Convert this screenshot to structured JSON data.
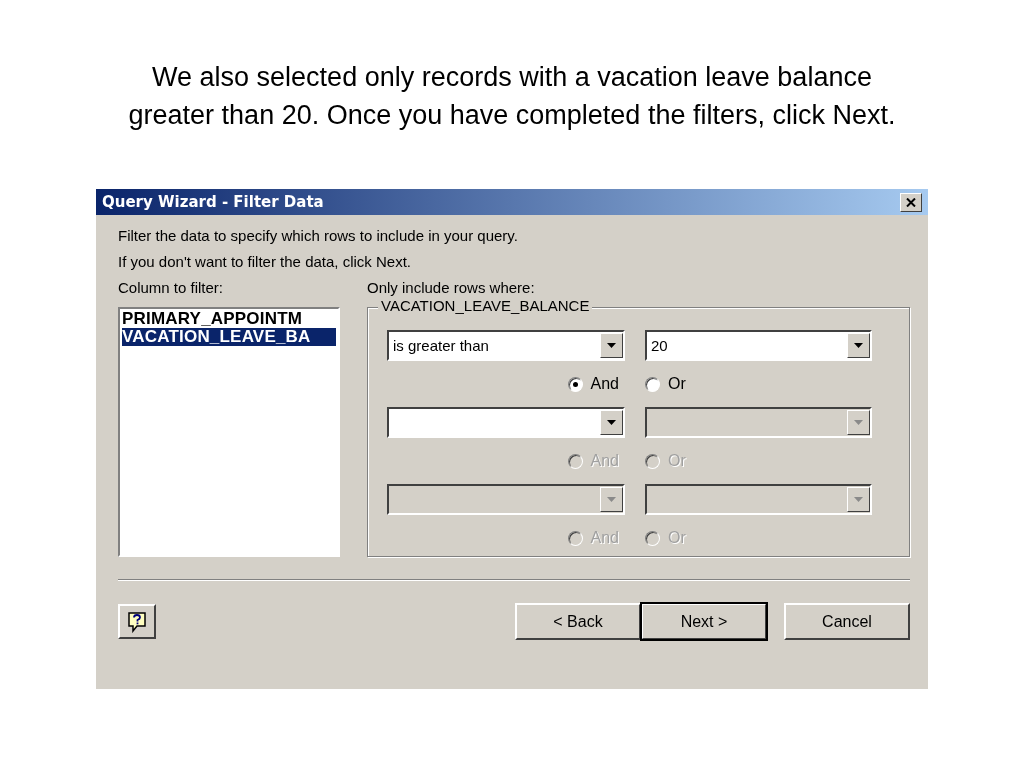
{
  "caption": [
    "We also selected only records with a vacation leave balance",
    "greater than 20. Once you have completed the filters, click Next."
  ],
  "window": {
    "title": "Query Wizard - Filter Data"
  },
  "intro": [
    "Filter the data to specify which rows to include in your query.",
    "If you don't want to filter the data, click Next."
  ],
  "column_label": "Column to filter:",
  "columns": [
    {
      "label": "PRIMARY_APPOINTM",
      "selected": false
    },
    {
      "label": "VACATION_LEAVE_BA",
      "selected": true
    }
  ],
  "criteria_label": "Only include rows where:",
  "group_title": "VACATION_LEAVE_BALANCE",
  "conditions": [
    {
      "operator": {
        "value": "is greater than",
        "disabled": false
      },
      "operand": {
        "value": "20",
        "disabled": false
      },
      "and": {
        "label": "And",
        "selected": true,
        "disabled": false
      },
      "or": {
        "label": "Or",
        "selected": false,
        "disabled": false
      }
    },
    {
      "operator": {
        "disabled": false
      },
      "operand": {
        "disabled": true
      },
      "and": {
        "label": "And",
        "selected": false,
        "disabled": true
      },
      "or": {
        "label": "Or",
        "selected": false,
        "disabled": true
      }
    },
    {
      "operator": {
        "disabled": true
      },
      "operand": {
        "disabled": true
      },
      "and": {
        "label": "And",
        "selected": false,
        "disabled": true
      },
      "or": {
        "label": "Or",
        "selected": false,
        "disabled": true
      }
    }
  ],
  "buttons": [
    {
      "label": "< Back",
      "default": false
    },
    {
      "label": "Next >",
      "default": true
    },
    {
      "label": "Cancel",
      "default": false
    }
  ]
}
